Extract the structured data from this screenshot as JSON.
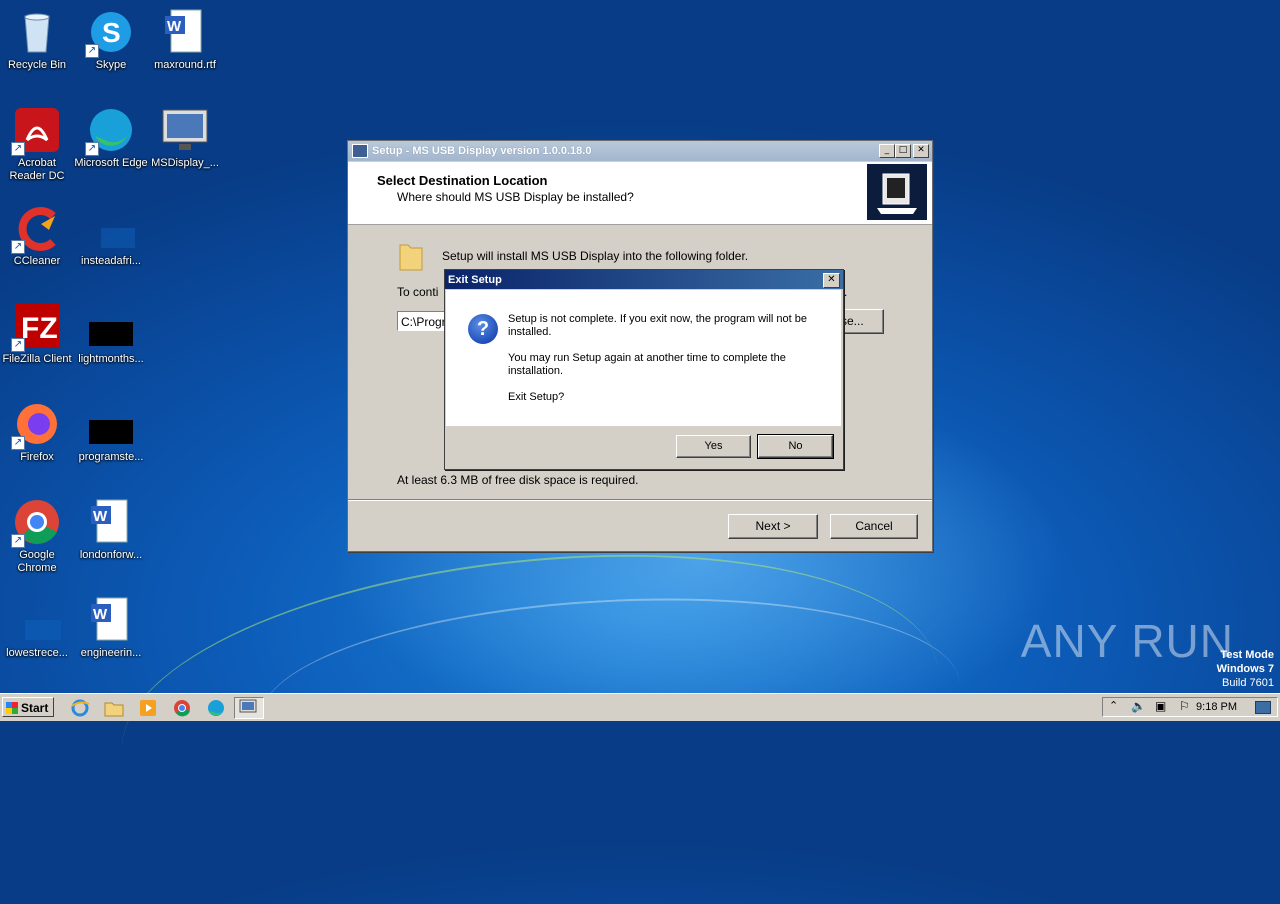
{
  "desktop": {
    "icons": [
      {
        "label": "Recycle Bin",
        "icon": "recycle-bin-icon"
      },
      {
        "label": "Skype",
        "icon": "skype-icon"
      },
      {
        "label": "maxround.rtf",
        "icon": "word-document-icon"
      },
      {
        "label": "Acrobat Reader DC",
        "icon": "acrobat-icon"
      },
      {
        "label": "Microsoft Edge",
        "icon": "edge-icon"
      },
      {
        "label": "MSDisplay_...",
        "icon": "monitor-icon"
      },
      {
        "label": "CCleaner",
        "icon": "ccleaner-icon"
      },
      {
        "label": "insteadafri...",
        "icon": "blank-file-icon"
      },
      {
        "label": "FileZilla Client",
        "icon": "filezilla-icon"
      },
      {
        "label": "lightmonths...",
        "icon": "black-file-icon"
      },
      {
        "label": "Firefox",
        "icon": "firefox-icon"
      },
      {
        "label": "programste...",
        "icon": "black-file-icon"
      },
      {
        "label": "Google Chrome",
        "icon": "chrome-icon"
      },
      {
        "label": "londonforw...",
        "icon": "word-document-icon"
      },
      {
        "label": "lowestrece...",
        "icon": "blank-file-icon"
      },
      {
        "label": "engineerin...",
        "icon": "word-document-icon"
      }
    ]
  },
  "setup": {
    "title": "Setup - MS USB Display version 1.0.0.18.0",
    "header_title": "Select Destination Location",
    "header_subtitle": "Where should MS USB Display be installed?",
    "install_text": "Setup will install MS USB Display into the following folder.",
    "continue_text": "To conti",
    "continue_text_tail": ".",
    "path_value": "C:\\Progr",
    "browse_label": "se...",
    "disk_space_text": "At least 6.3 MB of free disk space is required.",
    "next_label": "Next >",
    "cancel_label": "Cancel"
  },
  "exit_dialog": {
    "title": "Exit Setup",
    "line1": "Setup is not complete. If you exit now, the program will not be installed.",
    "line2": "You may run Setup again at another time to complete the installation.",
    "line3": "Exit Setup?",
    "yes_label": "Yes",
    "no_label": "No"
  },
  "taskbar": {
    "start_label": "Start",
    "clock": "9:18 PM",
    "apps": [
      "internet-explorer-icon",
      "explorer-folder-icon",
      "media-player-icon",
      "chrome-icon",
      "edge-icon",
      "setup-window-icon"
    ]
  },
  "watermark": "ANY RUN",
  "test_mode": {
    "line1": "Test Mode",
    "line2": "Windows 7",
    "line3": "Build 7601"
  }
}
